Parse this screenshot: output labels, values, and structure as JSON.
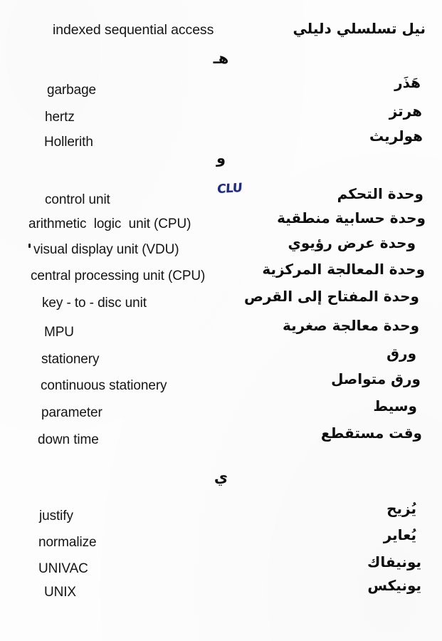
{
  "page": {
    "background_color": "#fdfdfd",
    "text_color": "#151515",
    "annotation_color": "#1d2a8c",
    "type": "scanned-bilingual-glossary-page"
  },
  "sections": [
    {
      "letter": "",
      "entries": [
        {
          "english": "indexed sequential access",
          "arabic": "نيل تسلسلي دليلي"
        }
      ]
    },
    {
      "letter": "هـ",
      "entries": [
        {
          "english": "garbage",
          "arabic": "هَذَر"
        },
        {
          "english": "hertz",
          "arabic": "هرتز"
        },
        {
          "english": "Hollerith",
          "arabic": "هولريث"
        }
      ]
    },
    {
      "letter": "و",
      "entries": [
        {
          "english": "control unit",
          "arabic": "وحدة التحكم"
        },
        {
          "english": "arithmetic  logic  unit (CPU)",
          "arabic": "وحدة حسابية منطقية"
        },
        {
          "english": "visual display unit (VDU)",
          "arabic": "وحدة عرض رؤيوي"
        },
        {
          "english": "central processing unit (CPU)",
          "arabic": "وحدة المعالجة المركزية"
        },
        {
          "english": "key - to - disc unit",
          "arabic": "وحدة المفتاح إلى القرص"
        },
        {
          "english": "MPU",
          "arabic": "وحدة معالجة صغرية"
        },
        {
          "english": "stationery",
          "arabic": "ورق"
        },
        {
          "english": "continuous stationery",
          "arabic": "ورق متواصل"
        },
        {
          "english": "parameter",
          "arabic": "وسيط"
        },
        {
          "english": "down time",
          "arabic": "وقت مستقطع"
        }
      ]
    },
    {
      "letter": "ي",
      "entries": [
        {
          "english": "justify",
          "arabic": "يُزيح"
        },
        {
          "english": "normalize",
          "arabic": "يُعاير"
        },
        {
          "english": "UNIVAC",
          "arabic": "يونيفاك"
        },
        {
          "english": "UNIX",
          "arabic": "يونيكس"
        }
      ]
    }
  ],
  "annotations": [
    {
      "text": "CLU",
      "color": "#1d2a8c",
      "style": "handwritten-ink"
    }
  ]
}
